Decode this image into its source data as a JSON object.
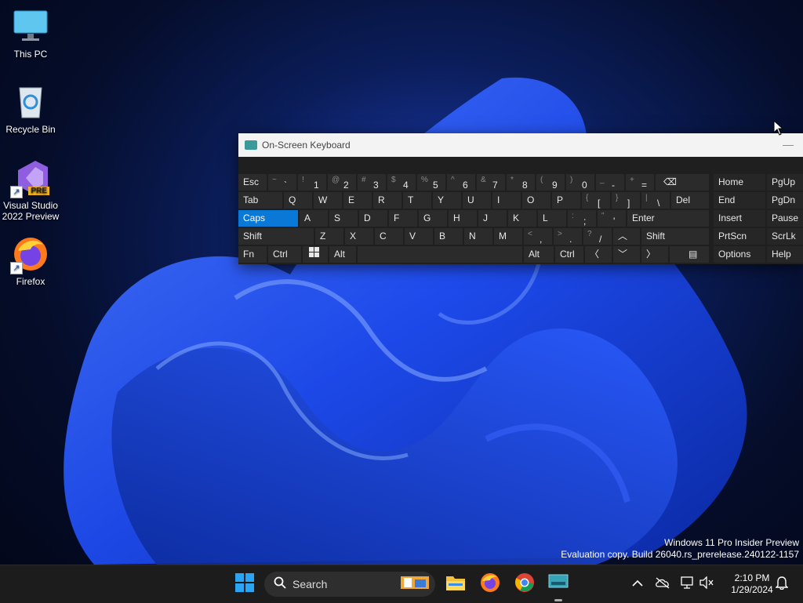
{
  "desktop": {
    "icons": [
      {
        "label": "This PC",
        "icon": "monitor-icon"
      },
      {
        "label": "Recycle Bin",
        "icon": "recycle-bin-icon"
      },
      {
        "label": "Visual Studio 2022 Preview",
        "icon": "visual-studio-icon",
        "badge": "PRE"
      },
      {
        "label": "Firefox",
        "icon": "firefox-icon"
      }
    ]
  },
  "osk": {
    "title": "On-Screen Keyboard",
    "row1": {
      "esc": "Esc",
      "tilde_top": "~",
      "tilde_bot": "`",
      "k1_top": "!",
      "k1": "1",
      "k2_top": "@",
      "k2": "2",
      "k3_top": "#",
      "k3": "3",
      "k4_top": "$",
      "k4": "4",
      "k5_top": "%",
      "k5": "5",
      "k6_top": "^",
      "k6": "6",
      "k7_top": "&",
      "k7": "7",
      "k8_top": "*",
      "k8": "8",
      "k9_top": "(",
      "k9": "9",
      "k0_top": ")",
      "k0": "0",
      "minus_top": "_",
      "minus": "-",
      "plus_top": "+",
      "plus": "="
    },
    "row2": {
      "tab": "Tab",
      "q": "Q",
      "w": "W",
      "e": "E",
      "r": "R",
      "t": "T",
      "y": "Y",
      "u": "U",
      "i": "I",
      "o": "O",
      "p": "P",
      "lb_top": "{",
      "lb": "[",
      "rb_top": "}",
      "rb": "]",
      "bs_top": "|",
      "bs": "\\",
      "del": "Del"
    },
    "row3": {
      "caps": "Caps",
      "a": "A",
      "s": "S",
      "d": "D",
      "f": "F",
      "g": "G",
      "h": "H",
      "j": "J",
      "k": "K",
      "l": "L",
      "semi_top": ":",
      "semi": ";",
      "quote_top": "\"",
      "quote": "'",
      "enter": "Enter"
    },
    "row4": {
      "shift": "Shift",
      "z": "Z",
      "x": "X",
      "c": "C",
      "v": "V",
      "b": "B",
      "n": "N",
      "m": "M",
      "comma_top": "<",
      "comma": ",",
      "period_top": ">",
      "period": ".",
      "slash_top": "?",
      "slash": "/",
      "rshift": "Shift"
    },
    "row5": {
      "fn": "Fn",
      "ctrl": "Ctrl",
      "alt": "Alt",
      "ralt": "Alt",
      "rctrl": "Ctrl"
    },
    "nav": {
      "home": "Home",
      "pgup": "PgUp",
      "end": "End",
      "pgdn": "PgDn",
      "insert": "Insert",
      "pause": "Pause",
      "prtscn": "PrtScn",
      "scrlk": "ScrLk",
      "options": "Options",
      "help": "Help"
    },
    "active_key": "Caps"
  },
  "watermark": {
    "line1": "Windows 11 Pro Insider Preview",
    "line2": "Evaluation copy. Build 26040.rs_prerelease.240122-1157"
  },
  "taskbar": {
    "search_label": "Search",
    "pinned": [
      "windows-start-icon",
      "file-explorer-icon",
      "firefox-icon",
      "chrome-icon",
      "on-screen-keyboard-icon"
    ],
    "clock_time": "2:10 PM",
    "clock_date": "1/29/2024"
  },
  "colors": {
    "accent": "#0a78d7",
    "taskbar": "#1c1c1c",
    "key": "#2b2b2b"
  }
}
